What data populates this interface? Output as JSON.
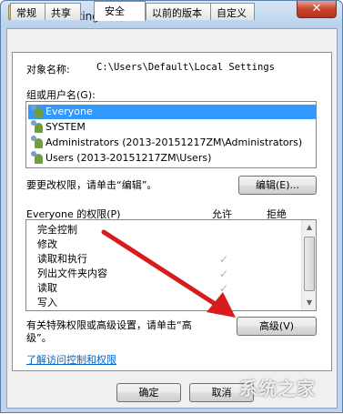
{
  "window": {
    "title": "Local Settings 属性",
    "close_glyph": "✕"
  },
  "tabs": [
    {
      "label": "常规"
    },
    {
      "label": "共享"
    },
    {
      "label": "安全"
    },
    {
      "label": "以前的版本"
    },
    {
      "label": "自定义"
    }
  ],
  "security": {
    "object_label": "对象名称:",
    "object_value": "C:\\Users\\Default\\Local Settings",
    "group_label": "组或用户名(G):",
    "users": [
      {
        "name": "Everyone"
      },
      {
        "name": "SYSTEM"
      },
      {
        "name": "Administrators (2013-20151217ZM\\Administrators)"
      },
      {
        "name": "Users (2013-20151217ZM\\Users)"
      }
    ],
    "edit_hint": "要更改权限，请单击“编辑”。",
    "edit_button": "编辑(E)...",
    "perm_title": "Everyone 的权限(P)",
    "allow_header": "允许",
    "deny_header": "拒绝",
    "permissions": [
      {
        "name": "完全控制",
        "allow": false
      },
      {
        "name": "修改",
        "allow": false
      },
      {
        "name": "读取和执行",
        "allow": true
      },
      {
        "name": "列出文件夹内容",
        "allow": true
      },
      {
        "name": "读取",
        "allow": true
      },
      {
        "name": "写入",
        "allow": false
      }
    ],
    "check_glyph": "✓",
    "advanced_hint_line1": "有关特殊权限或高级设置，请单击“高",
    "advanced_hint_line2": "级”。",
    "advanced_button": "高级(V)",
    "help_link": "了解访问控制和权限"
  },
  "footer": {
    "ok_button": "确定",
    "cancel_button": "取消"
  },
  "watermark": "系统之家",
  "colors": {
    "selection": "#3399ff",
    "annotation_arrow": "#d61c1c",
    "link": "#0066cc"
  }
}
